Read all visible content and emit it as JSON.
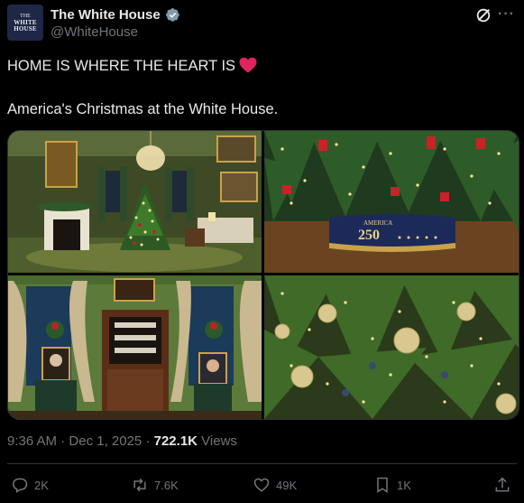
{
  "account": {
    "display_name": "The White House",
    "handle": "@WhiteHouse",
    "avatar_text": [
      "THE",
      "WHITE",
      "HOUSE"
    ]
  },
  "post": {
    "line1": "HOME IS WHERE THE HEART IS",
    "line2": "America's Christmas at the White House.",
    "heart_color": "#e0245e"
  },
  "media": {
    "images": [
      "green-room-christmas-tree",
      "tree-skirt-america-250",
      "portraits-and-cabinet",
      "tree-ornaments-closeup"
    ],
    "tree_skirt_text_top": "AMERICA",
    "tree_skirt_text_num": "250"
  },
  "meta": {
    "time": "9:36 AM",
    "dot": "·",
    "date": "Dec 1, 2025",
    "views_count": "722.1K",
    "views_label": "Views"
  },
  "actions": {
    "replies": "2K",
    "reposts": "7.6K",
    "likes": "49K",
    "bookmarks": "1K"
  },
  "colors": {
    "background": "#000000",
    "text": "#e7e9ea",
    "muted": "#71767b",
    "verified": "#829aab",
    "border": "#2f3336"
  }
}
